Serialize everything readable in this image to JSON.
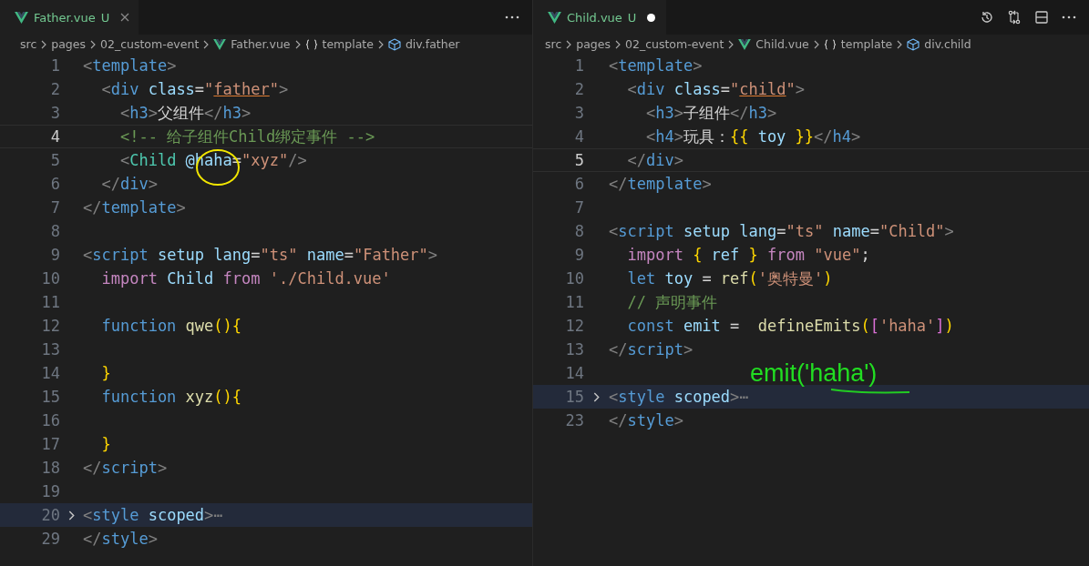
{
  "panes": [
    {
      "tab": {
        "name": "Father.vue",
        "status": "U",
        "modified": false
      },
      "breadcrumbs": [
        {
          "label": "src",
          "kind": "folder"
        },
        {
          "label": "pages",
          "kind": "folder"
        },
        {
          "label": "02_custom-event",
          "kind": "folder"
        },
        {
          "label": "Father.vue",
          "kind": "vue"
        },
        {
          "label": "template",
          "kind": "braces"
        },
        {
          "label": "div.father",
          "kind": "element"
        }
      ],
      "lines": [
        {
          "n": "1",
          "tokens": [
            {
              "kind": "punct",
              "t": "<"
            },
            {
              "kind": "tag",
              "t": "template"
            },
            {
              "kind": "punct",
              "t": ">"
            }
          ]
        },
        {
          "n": "2",
          "tokens": [
            {
              "kind": "punct",
              "t": "  <"
            },
            {
              "kind": "tag",
              "t": "div"
            },
            {
              "kind": "attr",
              "t": " class"
            },
            {
              "kind": "plain",
              "t": "="
            },
            {
              "kind": "string",
              "t": "\""
            },
            {
              "kind": "string",
              "t": "father",
              "underlined": true
            },
            {
              "kind": "string",
              "t": "\""
            },
            {
              "kind": "punct",
              "t": ">"
            }
          ]
        },
        {
          "n": "3",
          "tokens": [
            {
              "kind": "punct",
              "t": "    <"
            },
            {
              "kind": "tag",
              "t": "h3"
            },
            {
              "kind": "punct",
              "t": ">"
            },
            {
              "kind": "plain",
              "t": "父组件"
            },
            {
              "kind": "punct",
              "t": "</"
            },
            {
              "kind": "tag",
              "t": "h3"
            },
            {
              "kind": "punct",
              "t": ">"
            }
          ]
        },
        {
          "n": "4",
          "current": true,
          "tokens": [
            {
              "kind": "comment",
              "t": "    <!-- 给子组件Child绑定事件 -->"
            }
          ]
        },
        {
          "n": "5",
          "tokens": [
            {
              "kind": "punct",
              "t": "    <"
            },
            {
              "kind": "component",
              "t": "Child"
            },
            {
              "kind": "attr",
              "t": " @haha"
            },
            {
              "kind": "plain",
              "t": "="
            },
            {
              "kind": "string",
              "t": "\"xyz\""
            },
            {
              "kind": "punct",
              "t": "/>"
            }
          ]
        },
        {
          "n": "6",
          "tokens": [
            {
              "kind": "punct",
              "t": "  </"
            },
            {
              "kind": "tag",
              "t": "div"
            },
            {
              "kind": "punct",
              "t": ">"
            }
          ]
        },
        {
          "n": "7",
          "tokens": [
            {
              "kind": "punct",
              "t": "</"
            },
            {
              "kind": "tag",
              "t": "template"
            },
            {
              "kind": "punct",
              "t": ">"
            }
          ]
        },
        {
          "n": "8"
        },
        {
          "n": "9",
          "tokens": [
            {
              "kind": "punct",
              "t": "<"
            },
            {
              "kind": "tag",
              "t": "script"
            },
            {
              "kind": "attr",
              "t": " setup"
            },
            {
              "kind": "attr",
              "t": " lang"
            },
            {
              "kind": "plain",
              "t": "="
            },
            {
              "kind": "string",
              "t": "\"ts\""
            },
            {
              "kind": "attr",
              "t": " name"
            },
            {
              "kind": "plain",
              "t": "="
            },
            {
              "kind": "string",
              "t": "\"Father\""
            },
            {
              "kind": "punct",
              "t": ">"
            }
          ]
        },
        {
          "n": "10",
          "tokens": [
            {
              "kind": "keyword",
              "t": "  import"
            },
            {
              "kind": "variable",
              "t": " Child"
            },
            {
              "kind": "keyword",
              "t": " from"
            },
            {
              "kind": "string",
              "t": " './Child.vue'"
            }
          ]
        },
        {
          "n": "11"
        },
        {
          "n": "12",
          "tokens": [
            {
              "kind": "storage",
              "t": "  function"
            },
            {
              "kind": "function",
              "t": " qwe"
            },
            {
              "kind": "bracket",
              "t": "(){"
            }
          ]
        },
        {
          "n": "13"
        },
        {
          "n": "14",
          "tokens": [
            {
              "kind": "bracket",
              "t": "  }"
            }
          ]
        },
        {
          "n": "15",
          "tokens": [
            {
              "kind": "storage",
              "t": "  function"
            },
            {
              "kind": "function",
              "t": " xyz"
            },
            {
              "kind": "bracket",
              "t": "(){"
            }
          ]
        },
        {
          "n": "16"
        },
        {
          "n": "17",
          "tokens": [
            {
              "kind": "bracket",
              "t": "  }"
            }
          ]
        },
        {
          "n": "18",
          "tokens": [
            {
              "kind": "punct",
              "t": "</"
            },
            {
              "kind": "tag",
              "t": "script"
            },
            {
              "kind": "punct",
              "t": ">"
            }
          ]
        },
        {
          "n": "19"
        },
        {
          "n": "20",
          "folded": true,
          "tokens": [
            {
              "kind": "punct",
              "t": "<"
            },
            {
              "kind": "tag",
              "t": "style"
            },
            {
              "kind": "attr",
              "t": " scoped"
            },
            {
              "kind": "punct",
              "t": ">"
            },
            {
              "kind": "punct",
              "t": "⋯"
            }
          ]
        },
        {
          "n": "29",
          "tokens": [
            {
              "kind": "punct",
              "t": "</"
            },
            {
              "kind": "tag",
              "t": "style"
            },
            {
              "kind": "punct",
              "t": ">"
            }
          ]
        }
      ]
    },
    {
      "tab": {
        "name": "Child.vue",
        "status": "U",
        "modified": true
      },
      "breadcrumbs": [
        {
          "label": "src",
          "kind": "folder"
        },
        {
          "label": "pages",
          "kind": "folder"
        },
        {
          "label": "02_custom-event",
          "kind": "folder"
        },
        {
          "label": "Child.vue",
          "kind": "vue"
        },
        {
          "label": "template",
          "kind": "braces"
        },
        {
          "label": "div.child",
          "kind": "element"
        }
      ],
      "lines": [
        {
          "n": "1",
          "tokens": [
            {
              "kind": "punct",
              "t": "<"
            },
            {
              "kind": "tag",
              "t": "template"
            },
            {
              "kind": "punct",
              "t": ">"
            }
          ]
        },
        {
          "n": "2",
          "tokens": [
            {
              "kind": "punct",
              "t": "  <"
            },
            {
              "kind": "tag",
              "t": "div"
            },
            {
              "kind": "attr",
              "t": " class"
            },
            {
              "kind": "plain",
              "t": "="
            },
            {
              "kind": "string",
              "t": "\""
            },
            {
              "kind": "string",
              "t": "child",
              "underlined": true
            },
            {
              "kind": "string",
              "t": "\""
            },
            {
              "kind": "punct",
              "t": ">"
            }
          ]
        },
        {
          "n": "3",
          "tokens": [
            {
              "kind": "punct",
              "t": "    <"
            },
            {
              "kind": "tag",
              "t": "h3"
            },
            {
              "kind": "punct",
              "t": ">"
            },
            {
              "kind": "plain",
              "t": "子组件"
            },
            {
              "kind": "punct",
              "t": "</"
            },
            {
              "kind": "tag",
              "t": "h3"
            },
            {
              "kind": "punct",
              "t": ">"
            }
          ]
        },
        {
          "n": "4",
          "tokens": [
            {
              "kind": "punct",
              "t": "    <"
            },
            {
              "kind": "tag",
              "t": "h4"
            },
            {
              "kind": "punct",
              "t": ">"
            },
            {
              "kind": "plain",
              "t": "玩具："
            },
            {
              "kind": "bracket",
              "t": "{{"
            },
            {
              "kind": "variable",
              "t": " toy"
            },
            {
              "kind": "bracket",
              "t": " }}"
            },
            {
              "kind": "punct",
              "t": "</"
            },
            {
              "kind": "tag",
              "t": "h4"
            },
            {
              "kind": "punct",
              "t": ">"
            }
          ]
        },
        {
          "n": "5",
          "current": true,
          "tokens": [
            {
              "kind": "punct",
              "t": "  </"
            },
            {
              "kind": "tag",
              "t": "div"
            },
            {
              "kind": "punct",
              "t": ">"
            }
          ]
        },
        {
          "n": "6",
          "tokens": [
            {
              "kind": "punct",
              "t": "</"
            },
            {
              "kind": "tag",
              "t": "template"
            },
            {
              "kind": "punct",
              "t": ">"
            }
          ]
        },
        {
          "n": "7"
        },
        {
          "n": "8",
          "tokens": [
            {
              "kind": "punct",
              "t": "<"
            },
            {
              "kind": "tag",
              "t": "script"
            },
            {
              "kind": "attr",
              "t": " setup"
            },
            {
              "kind": "attr",
              "t": " lang"
            },
            {
              "kind": "plain",
              "t": "="
            },
            {
              "kind": "string",
              "t": "\"ts\""
            },
            {
              "kind": "attr",
              "t": " name"
            },
            {
              "kind": "plain",
              "t": "="
            },
            {
              "kind": "string",
              "t": "\"Child\""
            },
            {
              "kind": "punct",
              "t": ">"
            }
          ]
        },
        {
          "n": "9",
          "tokens": [
            {
              "kind": "keyword",
              "t": "  import"
            },
            {
              "kind": "bracket",
              "t": " {"
            },
            {
              "kind": "variable",
              "t": " ref"
            },
            {
              "kind": "bracket",
              "t": " }"
            },
            {
              "kind": "keyword",
              "t": " from"
            },
            {
              "kind": "string",
              "t": " \"vue\""
            },
            {
              "kind": "plain",
              "t": ";"
            }
          ]
        },
        {
          "n": "10",
          "tokens": [
            {
              "kind": "storage",
              "t": "  let"
            },
            {
              "kind": "variable",
              "t": " toy"
            },
            {
              "kind": "plain",
              "t": " = "
            },
            {
              "kind": "function",
              "t": "ref"
            },
            {
              "kind": "bracket",
              "t": "("
            },
            {
              "kind": "string",
              "t": "'奥特曼'"
            },
            {
              "kind": "bracket",
              "t": ")"
            }
          ]
        },
        {
          "n": "11",
          "tokens": [
            {
              "kind": "comment",
              "t": "  // 声明事件"
            }
          ]
        },
        {
          "n": "12",
          "tokens": [
            {
              "kind": "storage",
              "t": "  const"
            },
            {
              "kind": "variable",
              "t": " emit"
            },
            {
              "kind": "plain",
              "t": " =  "
            },
            {
              "kind": "function",
              "t": "defineEmits"
            },
            {
              "kind": "bracket",
              "t": "("
            },
            {
              "kind": "bracket2",
              "t": "["
            },
            {
              "kind": "string",
              "t": "'haha'"
            },
            {
              "kind": "bracket2",
              "t": "]"
            },
            {
              "kind": "bracket",
              "t": ")"
            }
          ]
        },
        {
          "n": "13",
          "tokens": [
            {
              "kind": "punct",
              "t": "</"
            },
            {
              "kind": "tag",
              "t": "script"
            },
            {
              "kind": "punct",
              "t": ">"
            }
          ]
        },
        {
          "n": "14",
          "annotation": "emit('haha')"
        },
        {
          "n": "15",
          "folded": true,
          "tokens": [
            {
              "kind": "punct",
              "t": "<"
            },
            {
              "kind": "tag",
              "t": "style"
            },
            {
              "kind": "attr",
              "t": " scoped"
            },
            {
              "kind": "punct",
              "t": ">"
            },
            {
              "kind": "punct",
              "t": "⋯"
            }
          ]
        },
        {
          "n": "23",
          "tokens": [
            {
              "kind": "punct",
              "t": "</"
            },
            {
              "kind": "tag",
              "t": "style"
            },
            {
              "kind": "punct",
              "t": ">"
            }
          ]
        }
      ]
    }
  ]
}
